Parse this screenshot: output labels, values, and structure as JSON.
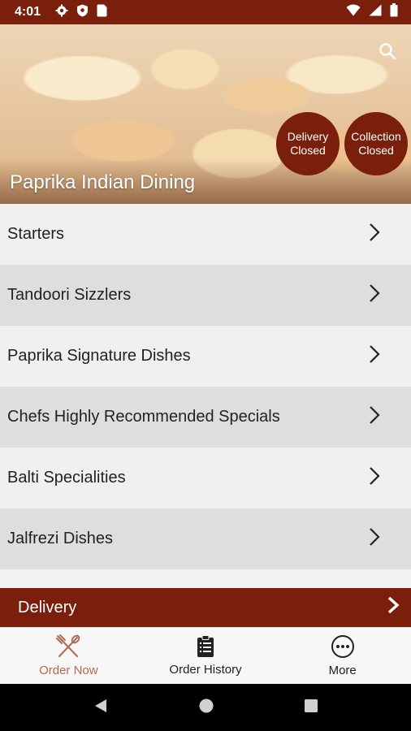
{
  "status_bar": {
    "time": "4:01",
    "left_icons": [
      "gear-icon",
      "shield-icon",
      "sim-card-icon"
    ],
    "right_icons": [
      "wifi-icon",
      "signal-icon",
      "battery-icon"
    ]
  },
  "hero": {
    "restaurant_name": "Paprika Indian Dining",
    "search_icon": "search-icon",
    "badges": [
      {
        "line1": "Delivery",
        "line2": "Closed"
      },
      {
        "line1": "Collection",
        "line2": "Closed"
      }
    ]
  },
  "menu": {
    "categories": [
      {
        "label": "Starters"
      },
      {
        "label": "Tandoori Sizzlers"
      },
      {
        "label": "Paprika Signature Dishes"
      },
      {
        "label": "Chefs Highly Recommended Specials"
      },
      {
        "label": "Balti Specialities"
      },
      {
        "label": "Jalfrezi Dishes"
      }
    ]
  },
  "delivery_bar": {
    "label": "Delivery"
  },
  "bottom_nav": {
    "items": [
      {
        "label": "Order Now",
        "icon": "fork-knife-icon",
        "active": true
      },
      {
        "label": "Order History",
        "icon": "clipboard-icon",
        "active": false
      },
      {
        "label": "More",
        "icon": "more-dots-icon",
        "active": false
      }
    ]
  },
  "colors": {
    "brand": "#7a1f0c",
    "active_nav": "#b06a56"
  }
}
